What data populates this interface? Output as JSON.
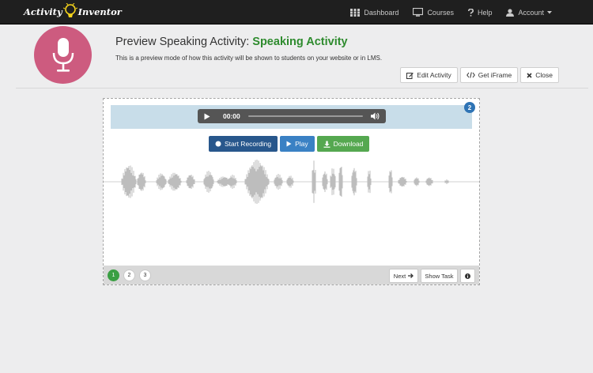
{
  "brand": {
    "name_part1": "Activity",
    "name_part2": "Inventor"
  },
  "nav": {
    "dashboard": "Dashboard",
    "courses": "Courses",
    "help": "Help",
    "account": "Account"
  },
  "header": {
    "title_prefix": "Preview Speaking Activity: ",
    "title_activity": "Speaking Activity",
    "description": "This is a preview mode of how this activity will be shown to students on your website or in LMS.",
    "edit_label": "Edit Activity",
    "iframe_label": "Get iFrame",
    "close_label": "Close"
  },
  "activity": {
    "badge": "2",
    "player": {
      "time": "00:00"
    },
    "start_recording_label": "Start Recording",
    "play_label": "Play",
    "download_label": "Download",
    "pages": [
      "1",
      "2",
      "3"
    ],
    "active_page": "1",
    "next_label": "Next",
    "show_task_label": "Show Task"
  },
  "colors": {
    "accent_title": "#2e8b2e",
    "mic_circle": "#cd5b7f",
    "record_button": "#28578c",
    "play_button": "#3a81c4",
    "download_button": "#55a850",
    "badge": "#2f74b5"
  }
}
